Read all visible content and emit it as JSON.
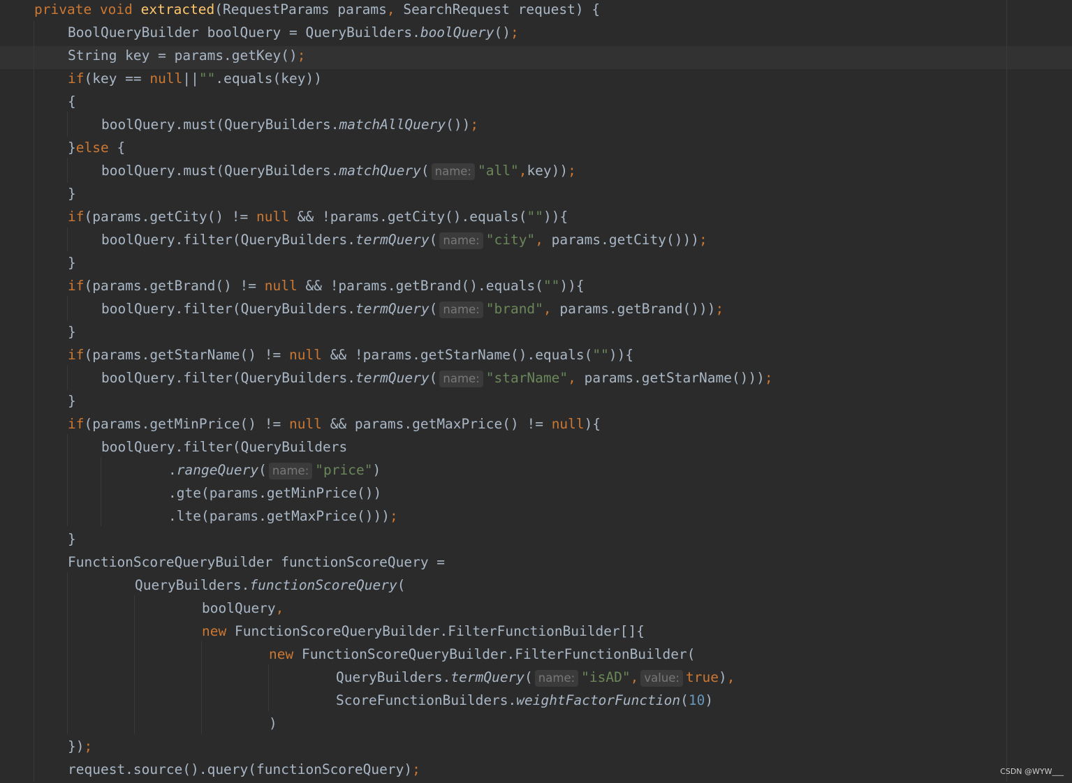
{
  "editor": {
    "lines": [
      {
        "indent": 0,
        "tokens": [
          [
            "kw",
            "private void "
          ],
          [
            "fn",
            "extracted"
          ],
          [
            "plain",
            "(RequestParams params"
          ],
          [
            "punct",
            ", "
          ],
          [
            "plain",
            "SearchRequest request) {"
          ]
        ]
      },
      {
        "indent": 1,
        "tokens": [
          [
            "plain",
            "BoolQueryBuilder boolQuery = QueryBuilders."
          ],
          [
            "static",
            "boolQuery"
          ],
          [
            "plain",
            "()"
          ],
          [
            "punct",
            ";"
          ]
        ]
      },
      {
        "indent": 1,
        "current": true,
        "tokens": [
          [
            "plain",
            "String key = params.getKey()"
          ],
          [
            "punct",
            ";"
          ]
        ]
      },
      {
        "indent": 1,
        "tokens": [
          [
            "kw",
            "if"
          ],
          [
            "plain",
            "(key == "
          ],
          [
            "kw",
            "null"
          ],
          [
            "plain",
            "||"
          ],
          [
            "str",
            "\"\""
          ],
          [
            "plain",
            ".equals(key))"
          ]
        ]
      },
      {
        "indent": 1,
        "tokens": [
          [
            "plain",
            "{"
          ]
        ]
      },
      {
        "indent": 2,
        "tokens": [
          [
            "plain",
            "boolQuery.must(QueryBuilders."
          ],
          [
            "static",
            "matchAllQuery"
          ],
          [
            "plain",
            "())"
          ],
          [
            "punct",
            ";"
          ]
        ]
      },
      {
        "indent": 1,
        "tokens": [
          [
            "plain",
            "}"
          ],
          [
            "kw",
            "else "
          ],
          [
            "plain",
            "{"
          ]
        ]
      },
      {
        "indent": 2,
        "tokens": [
          [
            "plain",
            "boolQuery.must(QueryBuilders."
          ],
          [
            "static",
            "matchQuery"
          ],
          [
            "plain",
            "("
          ],
          [
            "hint",
            "name:"
          ],
          [
            "str",
            "\"all\""
          ],
          [
            "punct",
            ","
          ],
          [
            "plain",
            "key))"
          ],
          [
            "punct",
            ";"
          ]
        ]
      },
      {
        "indent": 1,
        "tokens": [
          [
            "plain",
            "}"
          ]
        ]
      },
      {
        "indent": 1,
        "tokens": [
          [
            "kw",
            "if"
          ],
          [
            "plain",
            "(params.getCity() != "
          ],
          [
            "kw",
            "null"
          ],
          [
            "plain",
            " && !params.getCity().equals("
          ],
          [
            "str",
            "\"\""
          ],
          [
            "plain",
            "))"
          ],
          [
            "plain",
            "{"
          ]
        ]
      },
      {
        "indent": 2,
        "tokens": [
          [
            "plain",
            "boolQuery.filter(QueryBuilders."
          ],
          [
            "static",
            "termQuery"
          ],
          [
            "plain",
            "("
          ],
          [
            "hint",
            "name:"
          ],
          [
            "str",
            "\"city\""
          ],
          [
            "punct",
            ", "
          ],
          [
            "plain",
            "params.getCity()))"
          ],
          [
            "punct",
            ";"
          ]
        ]
      },
      {
        "indent": 1,
        "tokens": [
          [
            "plain",
            "}"
          ]
        ]
      },
      {
        "indent": 1,
        "tokens": [
          [
            "kw",
            "if"
          ],
          [
            "plain",
            "(params.getBrand() != "
          ],
          [
            "kw",
            "null"
          ],
          [
            "plain",
            " && !params.getBrand().equals("
          ],
          [
            "str",
            "\"\""
          ],
          [
            "plain",
            "))"
          ],
          [
            "plain",
            "{"
          ]
        ]
      },
      {
        "indent": 2,
        "tokens": [
          [
            "plain",
            "boolQuery.filter(QueryBuilders."
          ],
          [
            "static",
            "termQuery"
          ],
          [
            "plain",
            "("
          ],
          [
            "hint",
            "name:"
          ],
          [
            "str",
            "\"brand\""
          ],
          [
            "punct",
            ", "
          ],
          [
            "plain",
            "params.getBrand()))"
          ],
          [
            "punct",
            ";"
          ]
        ]
      },
      {
        "indent": 1,
        "tokens": [
          [
            "plain",
            "}"
          ]
        ]
      },
      {
        "indent": 1,
        "tokens": [
          [
            "kw",
            "if"
          ],
          [
            "plain",
            "(params.getStarName() != "
          ],
          [
            "kw",
            "null"
          ],
          [
            "plain",
            " && !params.getStarName().equals("
          ],
          [
            "str",
            "\"\""
          ],
          [
            "plain",
            "))"
          ],
          [
            "plain",
            "{"
          ]
        ]
      },
      {
        "indent": 2,
        "tokens": [
          [
            "plain",
            "boolQuery.filter(QueryBuilders."
          ],
          [
            "static",
            "termQuery"
          ],
          [
            "plain",
            "("
          ],
          [
            "hint",
            "name:"
          ],
          [
            "str",
            "\"starName\""
          ],
          [
            "punct",
            ", "
          ],
          [
            "plain",
            "params.getStarName()))"
          ],
          [
            "punct",
            ";"
          ]
        ]
      },
      {
        "indent": 1,
        "tokens": [
          [
            "plain",
            "}"
          ]
        ]
      },
      {
        "indent": 1,
        "tokens": [
          [
            "kw",
            "if"
          ],
          [
            "plain",
            "(params.getMinPrice() != "
          ],
          [
            "kw",
            "null"
          ],
          [
            "plain",
            " && params.getMaxPrice() != "
          ],
          [
            "kw",
            "null"
          ],
          [
            "plain",
            "){"
          ]
        ]
      },
      {
        "indent": 2,
        "tokens": [
          [
            "plain",
            "boolQuery.filter(QueryBuilders"
          ]
        ]
      },
      {
        "indent": 4,
        "tokens": [
          [
            "plain",
            "."
          ],
          [
            "static",
            "rangeQuery"
          ],
          [
            "plain",
            "("
          ],
          [
            "hint",
            "name:"
          ],
          [
            "str",
            "\"price\""
          ],
          [
            "plain",
            ")"
          ]
        ]
      },
      {
        "indent": 4,
        "tokens": [
          [
            "plain",
            ".gte(params.getMinPrice())"
          ]
        ]
      },
      {
        "indent": 4,
        "tokens": [
          [
            "plain",
            ".lte(params.getMaxPrice()))"
          ],
          [
            "punct",
            ";"
          ]
        ]
      },
      {
        "indent": 1,
        "tokens": [
          [
            "plain",
            "}"
          ]
        ]
      },
      {
        "indent": 1,
        "tokens": [
          [
            "plain",
            "FunctionScoreQueryBuilder functionScoreQuery ="
          ]
        ]
      },
      {
        "indent": 3,
        "tokens": [
          [
            "plain",
            "QueryBuilders."
          ],
          [
            "static",
            "functionScoreQuery"
          ],
          [
            "plain",
            "("
          ]
        ]
      },
      {
        "indent": 5,
        "tokens": [
          [
            "plain",
            "boolQuery"
          ],
          [
            "punct",
            ","
          ]
        ]
      },
      {
        "indent": 5,
        "tokens": [
          [
            "kw",
            "new "
          ],
          [
            "plain",
            "FunctionScoreQueryBuilder.FilterFunctionBuilder[]{"
          ]
        ]
      },
      {
        "indent": 7,
        "tokens": [
          [
            "kw",
            "new "
          ],
          [
            "plain",
            "FunctionScoreQueryBuilder.FilterFunctionBuilder("
          ]
        ]
      },
      {
        "indent": 9,
        "tokens": [
          [
            "plain",
            "QueryBuilders."
          ],
          [
            "static",
            "termQuery"
          ],
          [
            "plain",
            "("
          ],
          [
            "hint",
            "name:"
          ],
          [
            "str",
            "\"isAD\""
          ],
          [
            "punct",
            ","
          ],
          [
            "hint",
            "value:"
          ],
          [
            "kw",
            "true"
          ],
          [
            "plain",
            ")"
          ],
          [
            "punct",
            ","
          ]
        ]
      },
      {
        "indent": 9,
        "tokens": [
          [
            "plain",
            "ScoreFunctionBuilders."
          ],
          [
            "static",
            "weightFactorFunction"
          ],
          [
            "plain",
            "("
          ],
          [
            "num",
            "10"
          ],
          [
            "plain",
            ")"
          ]
        ]
      },
      {
        "indent": 7,
        "tokens": [
          [
            "plain",
            ")"
          ]
        ]
      },
      {
        "indent": 1,
        "tokens": [
          [
            "plain",
            "})"
          ],
          [
            "punct",
            ";"
          ]
        ]
      },
      {
        "indent": 1,
        "tokens": [
          [
            "plain",
            "request.source().query(functionScoreQuery)"
          ],
          [
            "punct",
            ";"
          ]
        ]
      }
    ]
  },
  "watermark": "CSDN @WYW___",
  "colors": {
    "background": "#2b2b2b",
    "keyword": "#cc7832",
    "method_decl": "#ffc66d",
    "string": "#6a8759",
    "number": "#6897bb",
    "text": "#a9b7c6",
    "hint": "#787878"
  }
}
